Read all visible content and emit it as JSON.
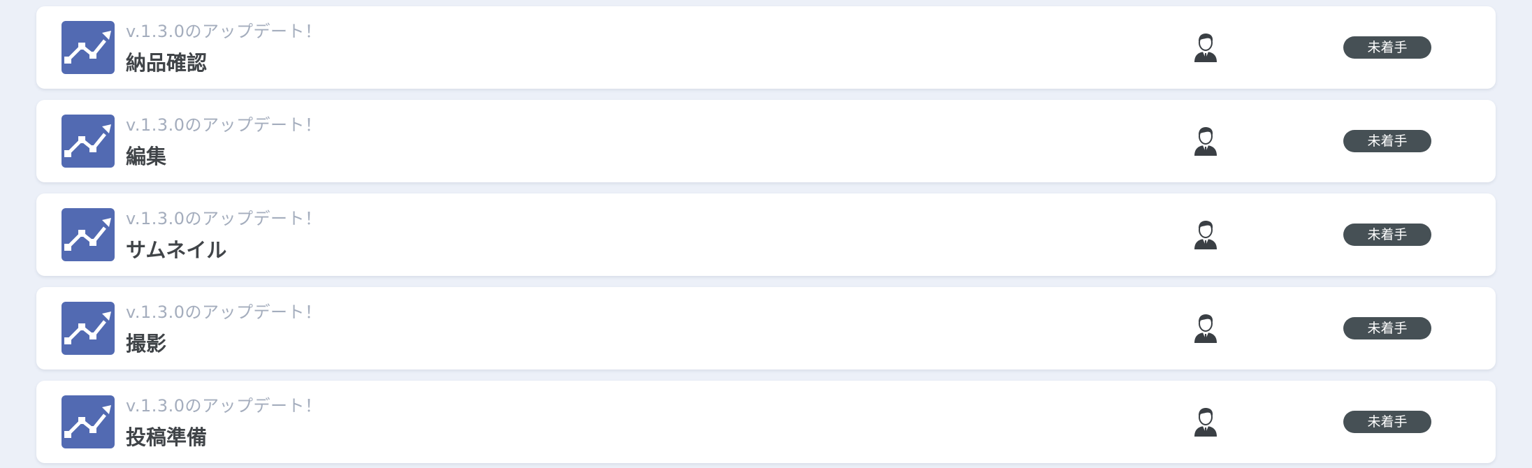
{
  "colors": {
    "page_background": "#ecf0f8",
    "card_background": "#ffffff",
    "project_icon_accent": "#526ab2",
    "status_badge": "#465055",
    "subtitle_text": "#a4adbd",
    "title_text": "#404448"
  },
  "icons": {
    "project": "trending-up-chart-icon",
    "assignee": "person-avatar-icon"
  },
  "tasks": [
    {
      "subtitle": "v.1.3.0のアップデート！",
      "title": "納品確認",
      "status": "未着手"
    },
    {
      "subtitle": "v.1.3.0のアップデート！",
      "title": "編集",
      "status": "未着手"
    },
    {
      "subtitle": "v.1.3.0のアップデート！",
      "title": "サムネイル",
      "status": "未着手"
    },
    {
      "subtitle": "v.1.3.0のアップデート！",
      "title": "撮影",
      "status": "未着手"
    },
    {
      "subtitle": "v.1.3.0のアップデート！",
      "title": "投稿準備",
      "status": "未着手"
    }
  ]
}
